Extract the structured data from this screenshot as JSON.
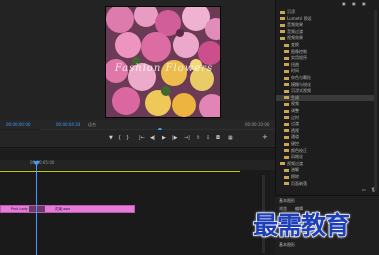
{
  "monitor": {
    "source_timecode": "00:00:00:00",
    "program_timecode": "00:00:04:24",
    "fit_label": "适合",
    "end_timecode": "00:00:10:00",
    "watermark_text": "Fashion Flowers"
  },
  "effects": {
    "items": [
      {
        "label": "沉浸",
        "type": "folder",
        "indent": 1
      },
      {
        "label": "Lumetri 预设",
        "type": "folder",
        "indent": 1
      },
      {
        "label": "音频效果",
        "type": "folder",
        "indent": 1
      },
      {
        "label": "音频过渡",
        "type": "folder",
        "indent": 1
      },
      {
        "label": "视频效果",
        "type": "folder",
        "indent": 1
      },
      {
        "label": "变换",
        "type": "folder",
        "indent": 2
      },
      {
        "label": "图像控制",
        "type": "folder",
        "indent": 2
      },
      {
        "label": "实用程序",
        "type": "folder",
        "indent": 2
      },
      {
        "label": "扭曲",
        "type": "folder",
        "indent": 2
      },
      {
        "label": "时间",
        "type": "folder",
        "indent": 2
      },
      {
        "label": "杂色与颗粒",
        "type": "folder",
        "indent": 2
      },
      {
        "label": "模糊与锐化",
        "type": "folder",
        "indent": 2
      },
      {
        "label": "沉浸式视频",
        "type": "folder",
        "indent": 2
      },
      {
        "label": "生成",
        "type": "folder",
        "indent": 2
      },
      {
        "label": "视频",
        "type": "folder",
        "indent": 2
      },
      {
        "label": "调整",
        "type": "folder",
        "indent": 2
      },
      {
        "label": "过时",
        "type": "folder",
        "indent": 2
      },
      {
        "label": "过渡",
        "type": "folder",
        "indent": 2
      },
      {
        "label": "透视",
        "type": "folder",
        "indent": 2
      },
      {
        "label": "通道",
        "type": "folder",
        "indent": 2
      },
      {
        "label": "键控",
        "type": "folder",
        "indent": 2
      },
      {
        "label": "颜色校正",
        "type": "folder",
        "indent": 2
      },
      {
        "label": "风格化",
        "type": "folder",
        "indent": 2
      },
      {
        "label": "视频过渡",
        "type": "folder",
        "indent": 1
      },
      {
        "label": "溶解",
        "type": "folder",
        "indent": 2
      },
      {
        "label": "擦除",
        "type": "folder",
        "indent": 2
      },
      {
        "label": "页面剥落",
        "type": "folder",
        "indent": 2
      }
    ],
    "selected_index": 13
  },
  "essential": {
    "title": "基本图形",
    "tab_browse": "浏览",
    "tab_edit": "编辑",
    "item": "我的模板",
    "footer": "基本图形"
  },
  "timeline": {
    "ruler_time": "00:00:05:00",
    "clip_label": "Pink Lady",
    "clip_label2": "花束.wav"
  },
  "overlay_logo": "最需教育"
}
